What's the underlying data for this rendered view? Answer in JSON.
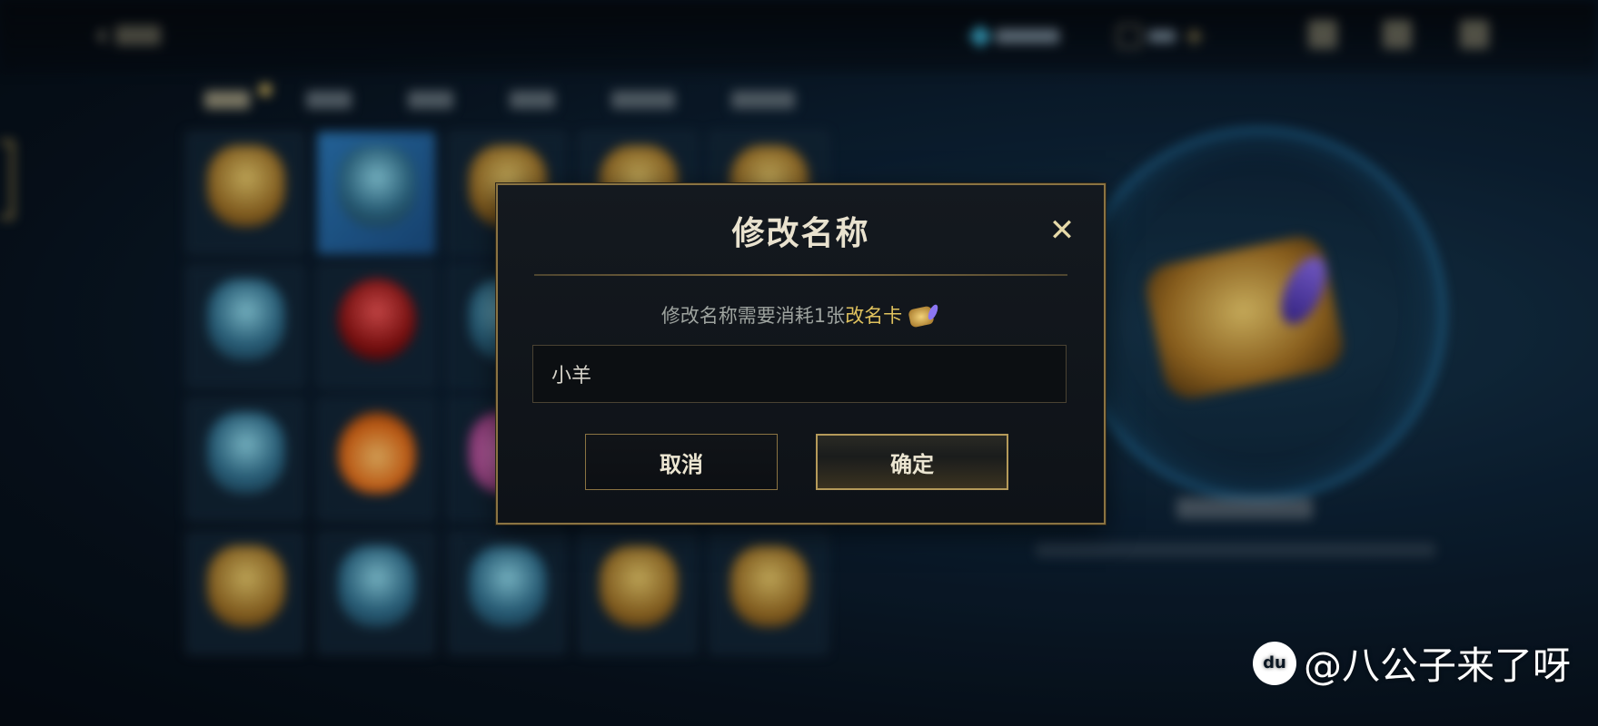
{
  "dialog": {
    "title": "修改名称",
    "close_symbol": "✕",
    "info_prefix": "修改名称需要消耗1张",
    "info_highlight": "改名卡",
    "input_value": "小羊",
    "cancel_label": "取消",
    "confirm_label": "确定"
  },
  "watermark": {
    "text": "@八公子来了呀",
    "logo_text": "du"
  }
}
